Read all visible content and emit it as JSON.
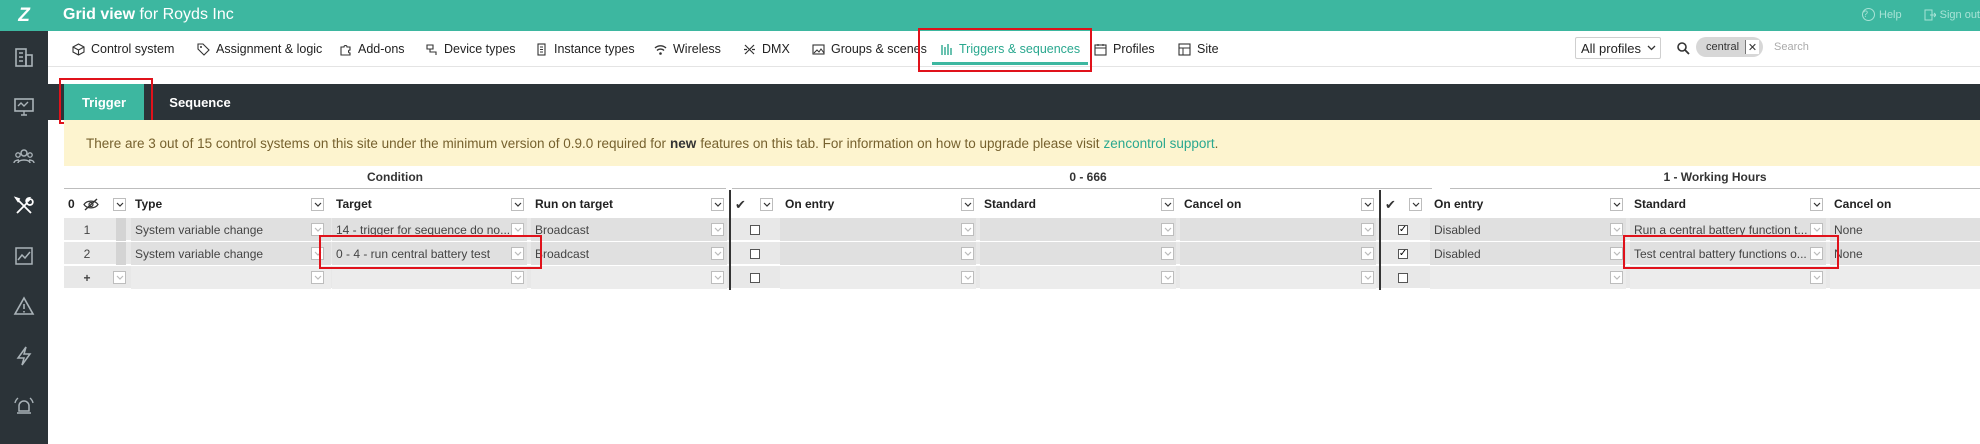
{
  "app": {
    "logo": "Z",
    "title_bold": "Grid view",
    "title_rest": " for Royds Inc",
    "help_label": "Help",
    "signout_label": "Sign out"
  },
  "sidebar": {
    "items": [
      {
        "icon": "building-icon"
      },
      {
        "icon": "monitor-icon"
      },
      {
        "icon": "users-icon"
      },
      {
        "icon": "tools-icon",
        "active": true
      },
      {
        "icon": "chart-icon"
      },
      {
        "icon": "warning-icon"
      },
      {
        "icon": "lightning-icon"
      },
      {
        "icon": "alarm-icon"
      }
    ]
  },
  "tabs": [
    {
      "label": "Control system",
      "icon": "cube-icon"
    },
    {
      "label": "Assignment & logic",
      "icon": "tag-icon"
    },
    {
      "label": "Add-ons",
      "icon": "puzzle-icon"
    },
    {
      "label": "Device types",
      "icon": "device-icon"
    },
    {
      "label": "Instance types",
      "icon": "list-icon"
    },
    {
      "label": "Wireless",
      "icon": "wifi-icon"
    },
    {
      "label": "DMX",
      "icon": "dmx-icon"
    },
    {
      "label": "Groups & scenes",
      "icon": "image-icon"
    },
    {
      "label": "Triggers & sequences",
      "icon": "bars-icon",
      "active": true
    },
    {
      "label": "Profiles",
      "icon": "calendar-icon"
    },
    {
      "label": "Site",
      "icon": "site-icon"
    }
  ],
  "profile_select": {
    "value": "All profiles"
  },
  "search": {
    "chip": "central",
    "placeholder": "Search"
  },
  "subtabs": [
    {
      "label": "Trigger",
      "active": true
    },
    {
      "label": "Sequence"
    }
  ],
  "notice": {
    "text_before": "There are 3 out of 15 control systems on this site under the minimum version of 0.9.0 required for",
    "bold": "new",
    "text_after": "features on this tab. For information on how to upgrade please visit",
    "link": "zencontrol support",
    "end": "."
  },
  "groups": {
    "condition": "Condition",
    "profile_a": "0 - 666",
    "profile_b": "1 - Working Hours"
  },
  "columns": {
    "count": "0",
    "type": "Type",
    "target": "Target",
    "run_on_target": "Run on target",
    "on_entry": "On entry",
    "standard": "Standard",
    "cancel_on": "Cancel on"
  },
  "rows": [
    {
      "num": "1",
      "type": "System variable change",
      "target": "14 - trigger for sequence do no...",
      "run_on_target": "Broadcast",
      "a_checked": false,
      "a_on_entry": "",
      "a_standard": "",
      "a_cancel": "",
      "b_checked": true,
      "b_on_entry": "Disabled",
      "b_standard": "Run a central battery function t...",
      "b_cancel": "None"
    },
    {
      "num": "2",
      "type": "System variable change",
      "target": "0 - 4 - run central battery test",
      "run_on_target": "Broadcast",
      "a_checked": false,
      "a_on_entry": "",
      "a_standard": "",
      "a_cancel": "",
      "b_checked": true,
      "b_on_entry": "Disabled",
      "b_standard": "Test central battery functions o...",
      "b_cancel": "None"
    }
  ],
  "new_row": {
    "marker": "+"
  },
  "colors": {
    "accent": "#3db7a0",
    "sidebar": "#2b3338",
    "notice_bg": "#fdf4cf",
    "highlight": "#e0121b"
  }
}
